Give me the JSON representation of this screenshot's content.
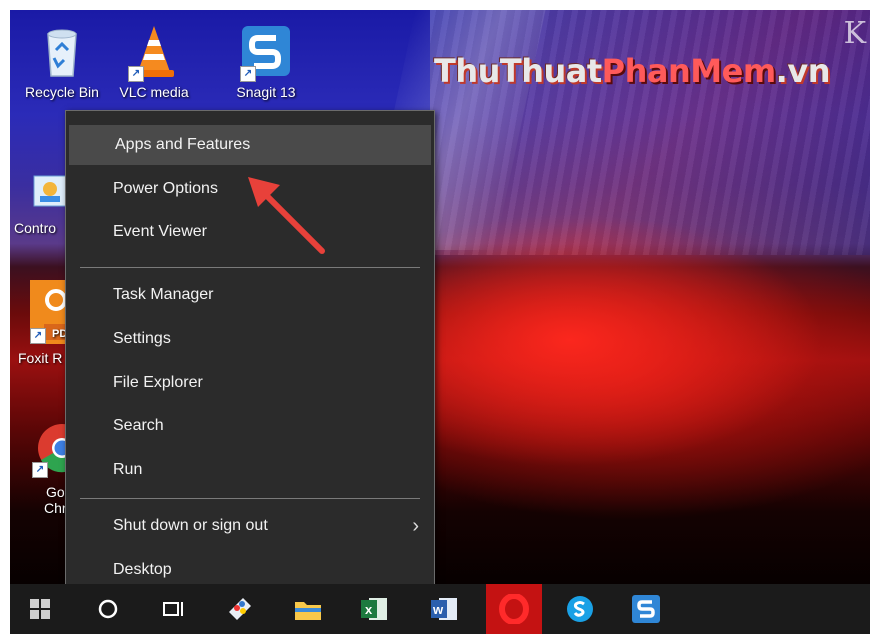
{
  "watermark": {
    "part1": "ThuThuat",
    "part2": "PhanMem",
    "part3": ".vn"
  },
  "wallpaper_letter": "K",
  "desktop_icons": [
    {
      "label": "Recycle Bin",
      "icon": "recycle-bin-icon"
    },
    {
      "label": "VLC media",
      "icon": "vlc-cone-icon"
    },
    {
      "label": "Snagit 13",
      "icon": "snagit-icon"
    },
    {
      "label": "Contro",
      "icon": "control-panel-icon"
    },
    {
      "label": "Foxit R",
      "icon": "foxit-reader-icon"
    },
    {
      "label": "Goo",
      "label2": "Chro",
      "icon": "chrome-icon"
    }
  ],
  "menu": {
    "items": [
      {
        "label": "Apps and Features",
        "highlighted": true
      },
      {
        "label": "Power Options"
      },
      {
        "label": "Event Viewer"
      },
      {
        "label": "Task Manager"
      },
      {
        "label": "Settings"
      },
      {
        "label": "File Explorer"
      },
      {
        "label": "Search"
      },
      {
        "label": "Run"
      },
      {
        "label": "Shut down or sign out",
        "has_submenu": true
      },
      {
        "label": "Desktop"
      }
    ],
    "submenu_glyph": "›"
  },
  "taskbar": {
    "buttons": [
      {
        "name": "start-button",
        "icon": "windows-logo-icon"
      },
      {
        "name": "cortana-button",
        "icon": "cortana-circle-icon"
      },
      {
        "name": "task-view-button",
        "icon": "task-view-icon"
      },
      {
        "name": "paint-app-button",
        "icon": "paint-icon"
      },
      {
        "name": "file-explorer-button",
        "icon": "folder-icon"
      },
      {
        "name": "excel-button",
        "icon": "excel-icon"
      },
      {
        "name": "word-button",
        "icon": "word-icon"
      },
      {
        "name": "opera-button",
        "icon": "opera-icon",
        "active": true
      },
      {
        "name": "skype-button",
        "icon": "skype-icon"
      },
      {
        "name": "snagit-taskbar-button",
        "icon": "snagit-icon"
      }
    ],
    "excel_letter": "x",
    "word_letter": "w"
  },
  "colors": {
    "menu_bg": "#2b2b2b",
    "menu_highlight": "#4a4a4a",
    "arrow": "#e8413a",
    "taskbar": "#1b1b1b"
  }
}
